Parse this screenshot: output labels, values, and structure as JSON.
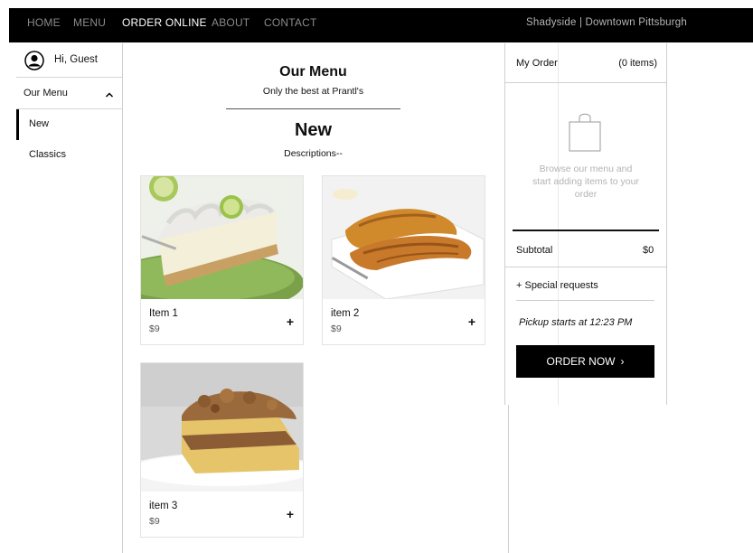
{
  "nav": {
    "links": [
      "HOME",
      "MENU",
      "ORDER ONLINE",
      "ABOUT",
      "CONTACT"
    ],
    "location": "Shadyside | Downtown Pittsburgh"
  },
  "sidebar": {
    "guest_label": "Hi, Guest",
    "menu_label": "Our Menu",
    "categories": [
      "New",
      "Classics"
    ],
    "active_category": "New"
  },
  "main": {
    "title": "Our Menu",
    "subtitle": "Only the best at Prantl's",
    "section_title": "New",
    "section_description": "Descriptions--",
    "add_symbol": "+",
    "items": [
      {
        "name": "Item 1",
        "price": "$9"
      },
      {
        "name": "item 2",
        "price": "$9"
      },
      {
        "name": "item 3",
        "price": "$9"
      }
    ]
  },
  "order": {
    "title": "My Order",
    "count": "(0 items)",
    "empty_message": "Browse our menu and start adding items to your order",
    "subtotal_label": "Subtotal",
    "subtotal_value": "$0",
    "special_requests": "+ Special requests",
    "pickup": "Pickup starts at 12:23 PM",
    "order_button": "ORDER NOW",
    "order_button_chevron": "›"
  },
  "colors": {
    "nav_bg": "#000000",
    "nav_active": "#ffffff",
    "nav_inactive": "#8a8a8a",
    "button_bg": "#000000",
    "muted_text": "#b3b3b3"
  },
  "icons": [
    "user-avatar-icon",
    "chevron-up-icon",
    "shopping-bag-icon",
    "plus-icon",
    "chevron-right-icon"
  ]
}
